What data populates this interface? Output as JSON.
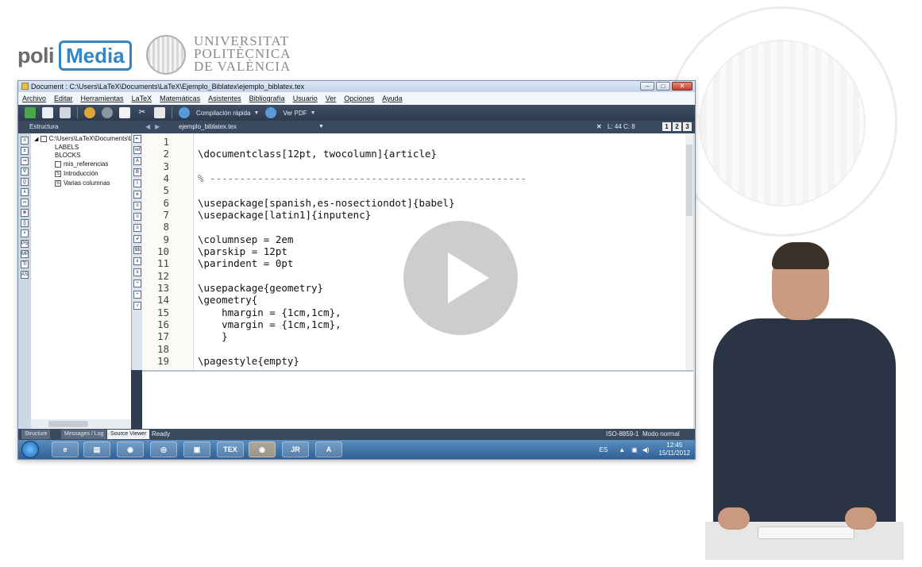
{
  "branding": {
    "poli": "poli",
    "media": "Media",
    "upv_line1": "UNIVERSITAT",
    "upv_line2": "POLITÈCNICA",
    "upv_line3": "DE VALÈNCIA"
  },
  "window": {
    "title": "Document : C:\\Users\\LaTeX\\Documents\\LaTeX\\Ejemplo_Biblatex\\ejemplo_biblatex.tex",
    "buttons": [
      "–",
      "□",
      "✕"
    ]
  },
  "menu": [
    "Archivo",
    "Editar",
    "Herramientas",
    "LaTeX",
    "Matemáticas",
    "Asistentes",
    "Bibliografía",
    "Usuario",
    "Ver",
    "Opciones",
    "Ayuda"
  ],
  "toolbar": {
    "quick_build": "Compilación rápida",
    "view_pdf": "Ver PDF"
  },
  "tabs": {
    "structure_label": "Estructura",
    "document_tab": "ejemplo_biblatex.tex",
    "position": "L: 44 C: 8",
    "view_buttons": [
      "1",
      "2",
      "3"
    ]
  },
  "structure": {
    "root": "C:\\Users\\LaTeX\\Documents\\L",
    "labels": "LABELS",
    "blocks": "BLOCKS",
    "items": [
      "mis_referencias",
      "Introducción",
      "Varias columnas"
    ]
  },
  "editor": {
    "line_numbers": [
      "1",
      "2",
      "3",
      "4",
      "5",
      "6",
      "7",
      "8",
      "9",
      "10",
      "11",
      "12",
      "13",
      "14",
      "15",
      "16",
      "17",
      "18",
      "19"
    ],
    "lines": [
      "",
      "\\documentclass[12pt, twocolumn]{article}",
      "",
      "% -----------------------------------------------------",
      "",
      "\\usepackage[spanish,es-nosectiondot]{babel}",
      "\\usepackage[latin1]{inputenc}",
      "",
      "\\columnsep = 2em",
      "\\parskip = 12pt",
      "\\parindent = 0pt",
      "",
      "\\usepackage{geometry}",
      "\\geometry{",
      "    hmargin = {1cm,1cm},",
      "    vmargin = {1cm,1cm},",
      "    }",
      "",
      "\\pagestyle{empty}"
    ]
  },
  "statusbar": {
    "tabs": [
      "Structure",
      "Messages / Log",
      "Source Viewer"
    ],
    "ready": "Ready",
    "encoding": "ISO-8859-1",
    "mode": "Modo normal"
  },
  "taskbar": {
    "lang": "ES",
    "time": "12:45",
    "date": "15/11/2012",
    "apps": [
      "e",
      "▤",
      "◉",
      "◎",
      "▣",
      "TEX",
      "◉",
      "JR",
      "A"
    ]
  }
}
